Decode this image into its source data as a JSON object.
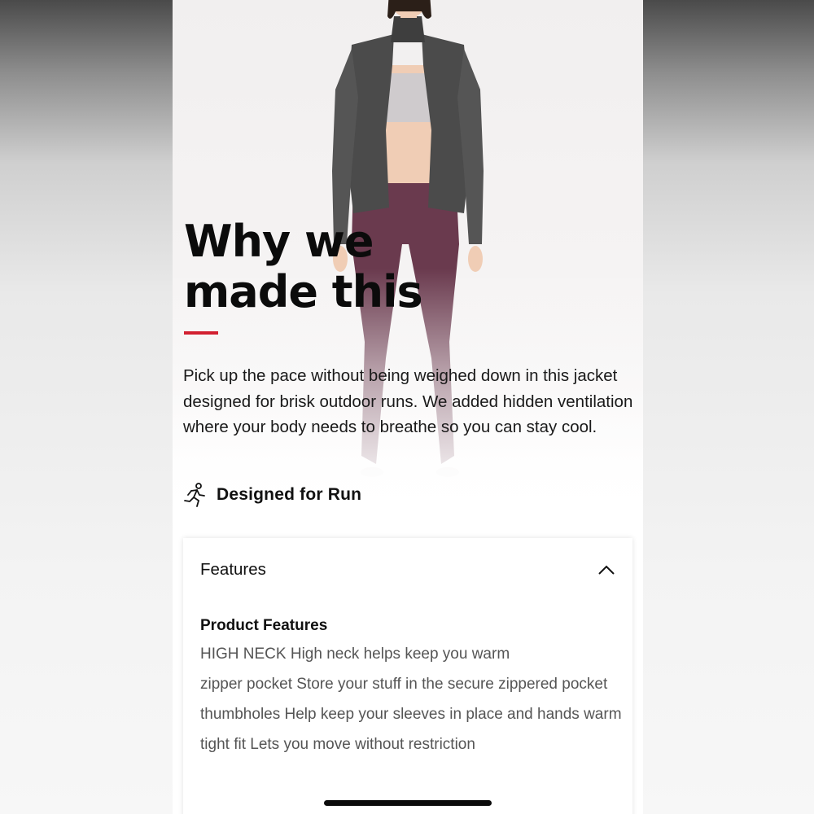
{
  "section": {
    "title": "Why we made this",
    "accent_color": "#d22030",
    "description": "Pick up the pace without being weighed down in this jacket designed for brisk outdoor runs. We added hidden ventilation where your body needs to breathe so you can stay cool."
  },
  "activity": {
    "icon": "running-person-icon",
    "label": "Designed for Run"
  },
  "features_card": {
    "title": "Features",
    "toggle_icon": "chevron-up-icon",
    "subtitle": "Product Features",
    "items": [
      "HIGH NECK High neck helps keep you warm",
      "zipper pocket Store your stuff in the secure zippered pocket",
      "thumbholes Help keep your sleeves in place and hands warm",
      "tight fit Lets you move without restriction"
    ]
  }
}
